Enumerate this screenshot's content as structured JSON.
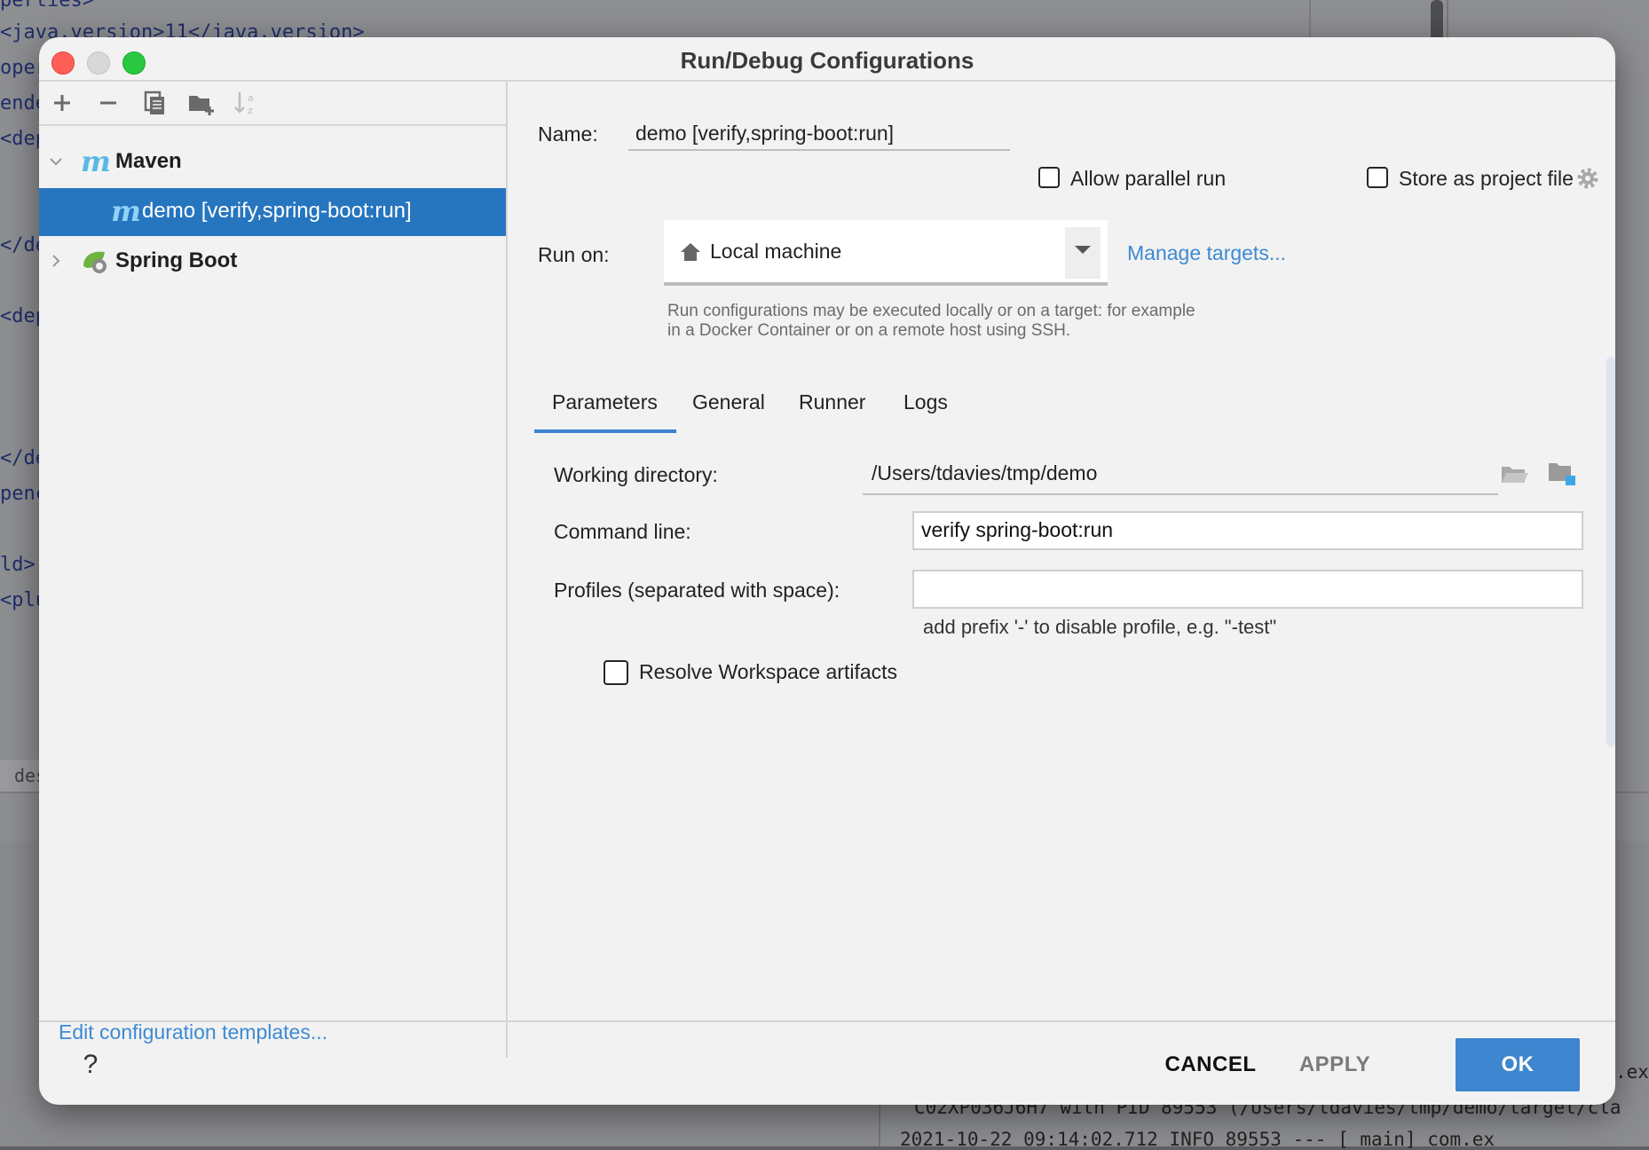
{
  "background": {
    "code_lines": [
      "perties>",
      "<java.version>11</java.version>",
      "oper",
      "ende",
      "<dep",
      "</de",
      "<dep",
      "</de",
      "penc",
      "ld>",
      "<plu"
    ],
    "tab_label": "des",
    "console_lines": [
      ".ex",
      "C02XP036J6H7 with PID 89553 (/Users/tdavies/tmp/demo/target/cla",
      "2021-10-22 09:14:02.712  INFO 89553 --- [           main] com.ex"
    ]
  },
  "dialog": {
    "title": "Run/Debug Configurations",
    "toolbar": {
      "add_icon": "plus-icon",
      "remove_icon": "minus-icon",
      "copy_icon": "copy-icon",
      "folder_icon": "new-folder-icon",
      "sort_icon": "sort-alphabetical-icon"
    },
    "tree": [
      {
        "label": "Maven",
        "icon": "maven-icon",
        "expanded": true
      },
      {
        "label": "demo [verify,spring-boot:run]",
        "icon": "maven-icon",
        "selected": true
      },
      {
        "label": "Spring Boot",
        "icon": "spring-boot-icon",
        "expanded": false
      }
    ],
    "edit_templates_link": "Edit configuration templates...",
    "config": {
      "name_label": "Name:",
      "name_value": "demo [verify,spring-boot:run]",
      "allow_parallel_label": "Allow parallel run",
      "store_project_label": "Store as project file",
      "run_on_label": "Run on:",
      "run_on_value": "Local machine",
      "manage_targets_link": "Manage targets...",
      "run_on_hint_line1": "Run configurations may be executed locally or on a target: for example",
      "run_on_hint_line2": "in a Docker Container or on a remote host using SSH.",
      "tabs": [
        {
          "label": "Parameters",
          "active": true
        },
        {
          "label": "General"
        },
        {
          "label": "Runner"
        },
        {
          "label": "Logs"
        }
      ],
      "working_dir_label": "Working directory:",
      "working_dir_value": "/Users/tdavies/tmp/demo",
      "command_line_label": "Command line:",
      "command_line_value": "verify spring-boot:run",
      "profiles_label": "Profiles (separated with space):",
      "profiles_value": "",
      "profiles_hint": "add prefix '-' to disable profile, e.g. \"-test\"",
      "resolve_workspace_label": "Resolve Workspace artifacts"
    },
    "footer": {
      "help_label": "?",
      "cancel_label": "CANCEL",
      "apply_label": "APPLY",
      "ok_label": "OK"
    },
    "colors": {
      "accent": "#3e86cf",
      "selection": "#2675bf",
      "link": "#3d8ad4"
    }
  }
}
